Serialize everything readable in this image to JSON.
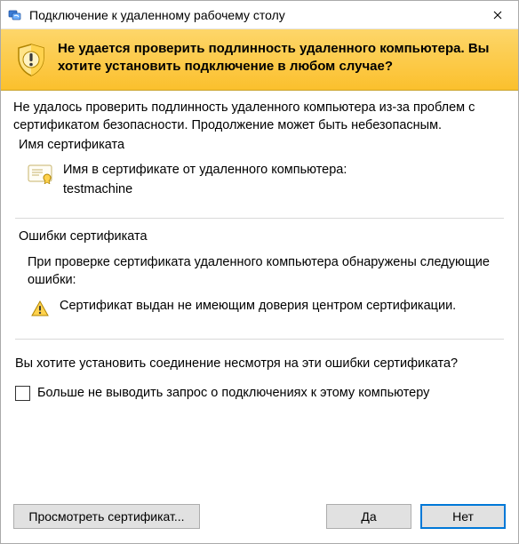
{
  "titlebar": {
    "title": "Подключение к удаленному рабочему столу"
  },
  "banner": {
    "message": "Не удается проверить подлинность удаленного компьютера. Вы хотите установить подключение в любом случае?"
  },
  "body": {
    "explain": "Не удалось проверить подлинность удаленного компьютера из-за проблем с сертификатом безопасности. Продолжение может быть небезопасным.",
    "cert_group_label": "Имя сертификата",
    "cert_label": "Имя в сертификате от удаленного компьютера:",
    "cert_value": "testmachine",
    "errors_group_label": "Ошибки сертификата",
    "errors_intro": "При проверке сертификата удаленного компьютера обнаружены следующие ошибки:",
    "error1": "Сертификат выдан не имеющим доверия центром сертификации.",
    "question": "Вы хотите установить соединение несмотря на эти ошибки сертификата?",
    "dont_ask_label": "Больше не выводить запрос о подключениях к этому компьютеру"
  },
  "footer": {
    "view_cert": "Просмотреть сертификат...",
    "yes": "Да",
    "no": "Нет"
  }
}
